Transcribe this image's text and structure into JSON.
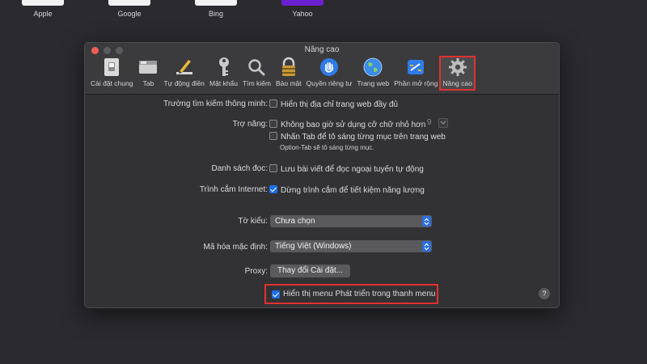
{
  "favorites": [
    {
      "name": "Apple"
    },
    {
      "name": "Google"
    },
    {
      "name": "Bing"
    },
    {
      "name": "Yahoo"
    }
  ],
  "window": {
    "title": "Nâng cao"
  },
  "toolbar": {
    "items": [
      {
        "label": "Cài đặt chung",
        "icon": "general-switch-icon"
      },
      {
        "label": "Tab",
        "icon": "tab-icon"
      },
      {
        "label": "Tự động điền",
        "icon": "pencil-icon"
      },
      {
        "label": "Mật khẩu",
        "icon": "key-icon"
      },
      {
        "label": "Tìm kiếm",
        "icon": "magnifier-icon"
      },
      {
        "label": "Bảo mật",
        "icon": "lock-icon"
      },
      {
        "label": "Quyền riêng tư",
        "icon": "hand-icon"
      },
      {
        "label": "Trang web",
        "icon": "globe-icon"
      },
      {
        "label": "Phần mở rộng",
        "icon": "puzzle-icon"
      },
      {
        "label": "Nâng cao",
        "icon": "gear-icon"
      }
    ],
    "active": "Nâng cao"
  },
  "settings": {
    "smart_search": {
      "label": "Trường tìm kiếm thông minh:",
      "option": "Hiển thị địa chỉ trang web đầy đủ",
      "checked": false
    },
    "accessibility": {
      "label": "Trợ năng:",
      "option1": "Không bao giờ sử dụng cỡ chữ nhỏ hơn",
      "option1_value": "9",
      "option1_checked": false,
      "option2": "Nhấn Tab để tô sáng từng mục trên trang web",
      "option2_checked": false,
      "hint": "Option-Tab sẽ tô sáng từng mục."
    },
    "reading_list": {
      "label": "Danh sách đọc:",
      "option": "Lưu bài viết để đọc ngoại tuyến tự động",
      "checked": false
    },
    "plugins": {
      "label": "Trình cắm Internet:",
      "option": "Dừng trình cắm để tiết kiệm năng lượng",
      "checked": true
    },
    "stylesheet": {
      "label": "Tờ kiểu:",
      "value": "Chưa chọn"
    },
    "encoding": {
      "label": "Mã hóa mặc định:",
      "value": "Tiếng Việt (Windows)"
    },
    "proxy": {
      "label": "Proxy:",
      "button": "Thay đổi Cài đặt..."
    },
    "develop_menu": {
      "option": "Hiển thị menu Phát triển trong thanh menu",
      "checked": true
    },
    "help": "?"
  },
  "colors": {
    "accent": "#1e6fe8",
    "highlight": "#e23030",
    "yahoo": "#6a1fd1"
  }
}
